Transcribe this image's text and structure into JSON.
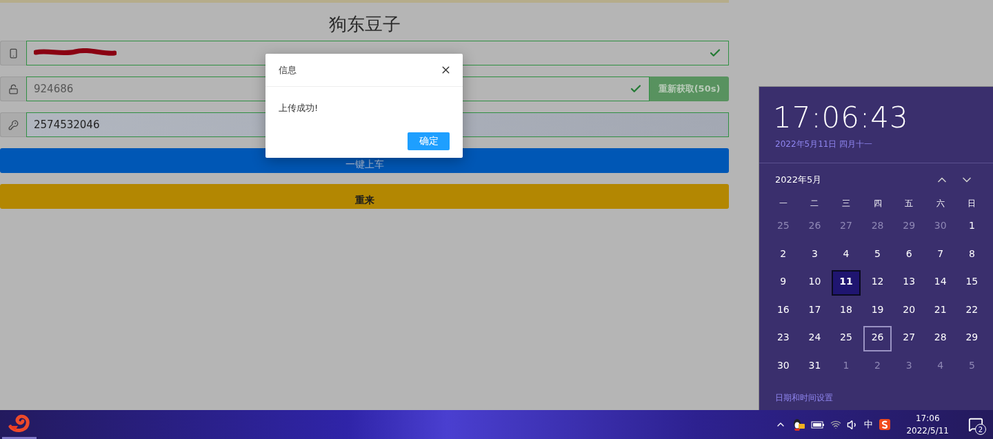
{
  "page": {
    "title": "狗东豆子",
    "fields": [
      {
        "kind": "phone",
        "redacted": true,
        "valid": true,
        "focused": false
      },
      {
        "kind": "code",
        "value": "924686",
        "valid": true,
        "focused": false,
        "button": "重新获取(50s)"
      },
      {
        "kind": "key",
        "value": "2574532046",
        "valid": false,
        "focused": true
      }
    ],
    "buttons": [
      {
        "label": "一键上车",
        "kind": "primary"
      },
      {
        "label": "重来",
        "kind": "warning"
      }
    ]
  },
  "dialog": {
    "title": "信息",
    "message": "上传成功!",
    "confirm": "确定"
  },
  "flyout": {
    "time": "17:06:43",
    "date": "2022年5月11日 四月十一",
    "month": "2022年5月",
    "weekdays": [
      "一",
      "二",
      "三",
      "四",
      "五",
      "六",
      "日"
    ],
    "days": [
      {
        "label": "25",
        "muted": true,
        "selected": false,
        "outlined": false
      },
      {
        "label": "26",
        "muted": true,
        "selected": false,
        "outlined": false
      },
      {
        "label": "27",
        "muted": true,
        "selected": false,
        "outlined": false
      },
      {
        "label": "28",
        "muted": true,
        "selected": false,
        "outlined": false
      },
      {
        "label": "29",
        "muted": true,
        "selected": false,
        "outlined": false
      },
      {
        "label": "30",
        "muted": true,
        "selected": false,
        "outlined": false
      },
      {
        "label": "1",
        "muted": false,
        "selected": false,
        "outlined": false
      },
      {
        "label": "2",
        "muted": false,
        "selected": false,
        "outlined": false
      },
      {
        "label": "3",
        "muted": false,
        "selected": false,
        "outlined": false
      },
      {
        "label": "4",
        "muted": false,
        "selected": false,
        "outlined": false
      },
      {
        "label": "5",
        "muted": false,
        "selected": false,
        "outlined": false
      },
      {
        "label": "6",
        "muted": false,
        "selected": false,
        "outlined": false
      },
      {
        "label": "7",
        "muted": false,
        "selected": false,
        "outlined": false
      },
      {
        "label": "8",
        "muted": false,
        "selected": false,
        "outlined": false
      },
      {
        "label": "9",
        "muted": false,
        "selected": false,
        "outlined": false
      },
      {
        "label": "10",
        "muted": false,
        "selected": false,
        "outlined": false
      },
      {
        "label": "11",
        "muted": false,
        "selected": true,
        "outlined": false
      },
      {
        "label": "12",
        "muted": false,
        "selected": false,
        "outlined": false
      },
      {
        "label": "13",
        "muted": false,
        "selected": false,
        "outlined": false
      },
      {
        "label": "14",
        "muted": false,
        "selected": false,
        "outlined": false
      },
      {
        "label": "15",
        "muted": false,
        "selected": false,
        "outlined": false
      },
      {
        "label": "16",
        "muted": false,
        "selected": false,
        "outlined": false
      },
      {
        "label": "17",
        "muted": false,
        "selected": false,
        "outlined": false
      },
      {
        "label": "18",
        "muted": false,
        "selected": false,
        "outlined": false
      },
      {
        "label": "19",
        "muted": false,
        "selected": false,
        "outlined": false
      },
      {
        "label": "20",
        "muted": false,
        "selected": false,
        "outlined": false
      },
      {
        "label": "21",
        "muted": false,
        "selected": false,
        "outlined": false
      },
      {
        "label": "22",
        "muted": false,
        "selected": false,
        "outlined": false
      },
      {
        "label": "23",
        "muted": false,
        "selected": false,
        "outlined": false
      },
      {
        "label": "24",
        "muted": false,
        "selected": false,
        "outlined": false
      },
      {
        "label": "25",
        "muted": false,
        "selected": false,
        "outlined": false
      },
      {
        "label": "26",
        "muted": false,
        "selected": false,
        "outlined": true
      },
      {
        "label": "27",
        "muted": false,
        "selected": false,
        "outlined": false
      },
      {
        "label": "28",
        "muted": false,
        "selected": false,
        "outlined": false
      },
      {
        "label": "29",
        "muted": false,
        "selected": false,
        "outlined": false
      },
      {
        "label": "30",
        "muted": false,
        "selected": false,
        "outlined": false
      },
      {
        "label": "31",
        "muted": false,
        "selected": false,
        "outlined": false
      },
      {
        "label": "1",
        "muted": true,
        "selected": false,
        "outlined": false
      },
      {
        "label": "2",
        "muted": true,
        "selected": false,
        "outlined": false
      },
      {
        "label": "3",
        "muted": true,
        "selected": false,
        "outlined": false
      },
      {
        "label": "4",
        "muted": true,
        "selected": false,
        "outlined": false
      },
      {
        "label": "5",
        "muted": true,
        "selected": false,
        "outlined": false
      }
    ],
    "settings_link": "日期和时间设置"
  },
  "taskbar": {
    "tray": [
      {
        "kind": "chevron"
      },
      {
        "kind": "qq"
      },
      {
        "kind": "battery"
      },
      {
        "kind": "wifi"
      },
      {
        "kind": "volume"
      },
      {
        "kind": "ime",
        "label": "中"
      },
      {
        "kind": "sogou"
      }
    ],
    "clock_time": "17:06",
    "clock_date": "2022/5/11",
    "notifications": "2"
  }
}
